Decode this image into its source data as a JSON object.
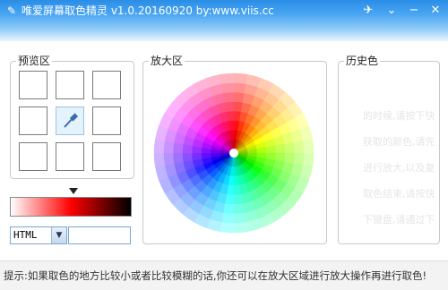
{
  "window": {
    "title": "唯爱屏幕取色精灵 v1.0.20160920 by:www.viis.cc",
    "app_icon": "eyedropper-icon",
    "buttons": {
      "pin": "pin-icon",
      "menu": "chevron-down-icon",
      "minimize": "minimize-icon",
      "close": "close-icon"
    }
  },
  "preview": {
    "label": "预览区",
    "gradient_colors": [
      "#ffffff",
      "#ff0000",
      "#000000"
    ],
    "selected_color": "#ff0000",
    "format_select": {
      "value": "HTML"
    },
    "color_value": ""
  },
  "magnifier": {
    "label": "放大区"
  },
  "history": {
    "label": "历史色",
    "faded_hints": [
      "的时候,请按下快",
      "获取的颜色,请先",
      "进行放大,以及复",
      "取色结束,请按快",
      "下键盘,请通过下"
    ]
  },
  "status": {
    "text": "提示:如果取色的地方比较小或者比较模糊的话,你还可以在放大区域进行放大操作再进行取色!"
  }
}
